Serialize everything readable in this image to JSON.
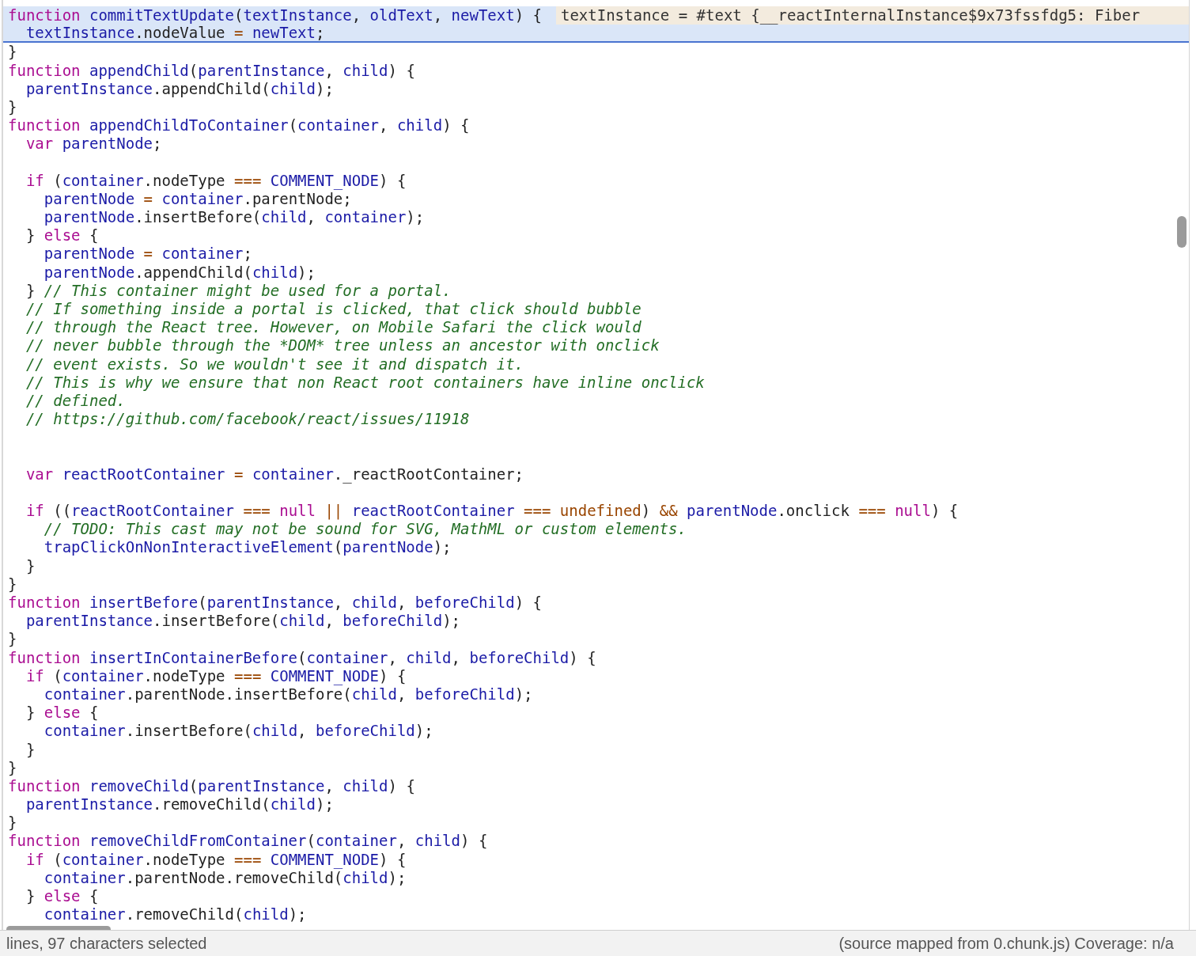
{
  "editor": {
    "lines": [
      {
        "highlighted": true,
        "tokens": [
          {
            "kind": "kw",
            "text": "function"
          },
          {
            "kind": "name",
            "text": " commitTextUpdate"
          },
          {
            "kind": "plain",
            "text": "("
          },
          {
            "kind": "name",
            "text": "textInstance"
          },
          {
            "kind": "plain",
            "text": ", "
          },
          {
            "kind": "name",
            "text": "oldText"
          },
          {
            "kind": "plain",
            "text": ", "
          },
          {
            "kind": "name",
            "text": "newText"
          },
          {
            "kind": "plain",
            "text": ") {"
          }
        ],
        "inline_value": "textInstance = #text {__reactInternalInstance$9x73fssfdg5: Fiber"
      },
      {
        "highlighted": true,
        "tokens": [
          {
            "kind": "name",
            "text": "  textInstance"
          },
          {
            "kind": "plain",
            "text": ".nodeValue "
          },
          {
            "kind": "op",
            "text": "="
          },
          {
            "kind": "name",
            "text": " newText"
          },
          {
            "kind": "plain",
            "text": ";"
          }
        ]
      },
      {
        "highlighted": false,
        "tokens": [
          {
            "kind": "plain",
            "text": "}"
          }
        ]
      },
      {
        "highlighted": false,
        "tokens": [
          {
            "kind": "kw",
            "text": "function"
          },
          {
            "kind": "name",
            "text": " appendChild"
          },
          {
            "kind": "plain",
            "text": "("
          },
          {
            "kind": "name",
            "text": "parentInstance"
          },
          {
            "kind": "plain",
            "text": ", "
          },
          {
            "kind": "name",
            "text": "child"
          },
          {
            "kind": "plain",
            "text": ") {"
          }
        ]
      },
      {
        "highlighted": false,
        "tokens": [
          {
            "kind": "name",
            "text": "  parentInstance"
          },
          {
            "kind": "plain",
            "text": ".appendChild("
          },
          {
            "kind": "name",
            "text": "child"
          },
          {
            "kind": "plain",
            "text": ");"
          }
        ]
      },
      {
        "highlighted": false,
        "tokens": [
          {
            "kind": "plain",
            "text": "}"
          }
        ]
      },
      {
        "highlighted": false,
        "tokens": [
          {
            "kind": "kw",
            "text": "function"
          },
          {
            "kind": "name",
            "text": " appendChildToContainer"
          },
          {
            "kind": "plain",
            "text": "("
          },
          {
            "kind": "name",
            "text": "container"
          },
          {
            "kind": "plain",
            "text": ", "
          },
          {
            "kind": "name",
            "text": "child"
          },
          {
            "kind": "plain",
            "text": ") {"
          }
        ]
      },
      {
        "highlighted": false,
        "tokens": [
          {
            "kind": "kw",
            "text": "  var"
          },
          {
            "kind": "name",
            "text": " parentNode"
          },
          {
            "kind": "plain",
            "text": ";"
          }
        ]
      },
      {
        "highlighted": false
      },
      {
        "highlighted": false,
        "tokens": [
          {
            "kind": "kw",
            "text": "  if"
          },
          {
            "kind": "plain",
            "text": " ("
          },
          {
            "kind": "name",
            "text": "container"
          },
          {
            "kind": "plain",
            "text": ".nodeType "
          },
          {
            "kind": "op",
            "text": "==="
          },
          {
            "kind": "name",
            "text": " COMMENT_NODE"
          },
          {
            "kind": "plain",
            "text": ") {"
          }
        ]
      },
      {
        "highlighted": false,
        "tokens": [
          {
            "kind": "name",
            "text": "    parentNode"
          },
          {
            "kind": "op",
            "text": " ="
          },
          {
            "kind": "name",
            "text": " container"
          },
          {
            "kind": "plain",
            "text": ".parentNode;"
          }
        ]
      },
      {
        "highlighted": false,
        "tokens": [
          {
            "kind": "name",
            "text": "    parentNode"
          },
          {
            "kind": "plain",
            "text": ".insertBefore("
          },
          {
            "kind": "name",
            "text": "child"
          },
          {
            "kind": "plain",
            "text": ", "
          },
          {
            "kind": "name",
            "text": "container"
          },
          {
            "kind": "plain",
            "text": ");"
          }
        ]
      },
      {
        "highlighted": false,
        "tokens": [
          {
            "kind": "plain",
            "text": "  } "
          },
          {
            "kind": "kw",
            "text": "else"
          },
          {
            "kind": "plain",
            "text": " {"
          }
        ]
      },
      {
        "highlighted": false,
        "tokens": [
          {
            "kind": "name",
            "text": "    parentNode"
          },
          {
            "kind": "op",
            "text": " ="
          },
          {
            "kind": "name",
            "text": " container"
          },
          {
            "kind": "plain",
            "text": ";"
          }
        ]
      },
      {
        "highlighted": false,
        "tokens": [
          {
            "kind": "name",
            "text": "    parentNode"
          },
          {
            "kind": "plain",
            "text": ".appendChild("
          },
          {
            "kind": "name",
            "text": "child"
          },
          {
            "kind": "plain",
            "text": ");"
          }
        ]
      },
      {
        "highlighted": false,
        "tokens": [
          {
            "kind": "plain",
            "text": "  } "
          },
          {
            "kind": "comment",
            "text": "// This container might be used for a portal."
          }
        ]
      },
      {
        "highlighted": false,
        "tokens": [
          {
            "kind": "comment",
            "text": "  // If something inside a portal is clicked, that click should bubble"
          }
        ]
      },
      {
        "highlighted": false,
        "tokens": [
          {
            "kind": "comment",
            "text": "  // through the React tree. However, on Mobile Safari the click would"
          }
        ]
      },
      {
        "highlighted": false,
        "tokens": [
          {
            "kind": "comment",
            "text": "  // never bubble through the *DOM* tree unless an ancestor with onclick"
          }
        ]
      },
      {
        "highlighted": false,
        "tokens": [
          {
            "kind": "comment",
            "text": "  // event exists. So we wouldn't see it and dispatch it."
          }
        ]
      },
      {
        "highlighted": false,
        "tokens": [
          {
            "kind": "comment",
            "text": "  // This is why we ensure that non React root containers have inline onclick"
          }
        ]
      },
      {
        "highlighted": false,
        "tokens": [
          {
            "kind": "comment",
            "text": "  // defined."
          }
        ]
      },
      {
        "highlighted": false,
        "tokens": [
          {
            "kind": "comment",
            "text": "  // https://github.com/facebook/react/issues/11918"
          }
        ]
      },
      {
        "highlighted": false
      },
      {
        "highlighted": false
      },
      {
        "highlighted": false,
        "tokens": [
          {
            "kind": "kw",
            "text": "  var"
          },
          {
            "kind": "name",
            "text": " reactRootContainer"
          },
          {
            "kind": "op",
            "text": " ="
          },
          {
            "kind": "name",
            "text": " container"
          },
          {
            "kind": "plain",
            "text": "._reactRootContainer;"
          }
        ]
      },
      {
        "highlighted": false
      },
      {
        "highlighted": false,
        "tokens": [
          {
            "kind": "kw",
            "text": "  if"
          },
          {
            "kind": "plain",
            "text": " (("
          },
          {
            "kind": "name",
            "text": "reactRootContainer"
          },
          {
            "kind": "op",
            "text": " ==="
          },
          {
            "kind": "kw",
            "text": " null"
          },
          {
            "kind": "op",
            "text": " ||"
          },
          {
            "kind": "name",
            "text": " reactRootContainer"
          },
          {
            "kind": "op",
            "text": " ==="
          },
          {
            "kind": "atom",
            "text": " undefined"
          },
          {
            "kind": "plain",
            "text": ") "
          },
          {
            "kind": "op",
            "text": "&&"
          },
          {
            "kind": "name",
            "text": " parentNode"
          },
          {
            "kind": "plain",
            "text": ".onclick "
          },
          {
            "kind": "op",
            "text": "==="
          },
          {
            "kind": "kw",
            "text": " null"
          },
          {
            "kind": "plain",
            "text": ") {"
          }
        ]
      },
      {
        "highlighted": false,
        "tokens": [
          {
            "kind": "comment",
            "text": "    // TODO: This cast may not be sound for SVG, MathML or custom elements."
          }
        ]
      },
      {
        "highlighted": false,
        "tokens": [
          {
            "kind": "name",
            "text": "    trapClickOnNonInteractiveElement"
          },
          {
            "kind": "plain",
            "text": "("
          },
          {
            "kind": "name",
            "text": "parentNode"
          },
          {
            "kind": "plain",
            "text": ");"
          }
        ]
      },
      {
        "highlighted": false,
        "tokens": [
          {
            "kind": "plain",
            "text": "  }"
          }
        ]
      },
      {
        "highlighted": false,
        "tokens": [
          {
            "kind": "plain",
            "text": "}"
          }
        ]
      },
      {
        "highlighted": false,
        "tokens": [
          {
            "kind": "kw",
            "text": "function"
          },
          {
            "kind": "name",
            "text": " insertBefore"
          },
          {
            "kind": "plain",
            "text": "("
          },
          {
            "kind": "name",
            "text": "parentInstance"
          },
          {
            "kind": "plain",
            "text": ", "
          },
          {
            "kind": "name",
            "text": "child"
          },
          {
            "kind": "plain",
            "text": ", "
          },
          {
            "kind": "name",
            "text": "beforeChild"
          },
          {
            "kind": "plain",
            "text": ") {"
          }
        ]
      },
      {
        "highlighted": false,
        "tokens": [
          {
            "kind": "name",
            "text": "  parentInstance"
          },
          {
            "kind": "plain",
            "text": ".insertBefore("
          },
          {
            "kind": "name",
            "text": "child"
          },
          {
            "kind": "plain",
            "text": ", "
          },
          {
            "kind": "name",
            "text": "beforeChild"
          },
          {
            "kind": "plain",
            "text": ");"
          }
        ]
      },
      {
        "highlighted": false,
        "tokens": [
          {
            "kind": "plain",
            "text": "}"
          }
        ]
      },
      {
        "highlighted": false,
        "tokens": [
          {
            "kind": "kw",
            "text": "function"
          },
          {
            "kind": "name",
            "text": " insertInContainerBefore"
          },
          {
            "kind": "plain",
            "text": "("
          },
          {
            "kind": "name",
            "text": "container"
          },
          {
            "kind": "plain",
            "text": ", "
          },
          {
            "kind": "name",
            "text": "child"
          },
          {
            "kind": "plain",
            "text": ", "
          },
          {
            "kind": "name",
            "text": "beforeChild"
          },
          {
            "kind": "plain",
            "text": ") {"
          }
        ]
      },
      {
        "highlighted": false,
        "tokens": [
          {
            "kind": "kw",
            "text": "  if"
          },
          {
            "kind": "plain",
            "text": " ("
          },
          {
            "kind": "name",
            "text": "container"
          },
          {
            "kind": "plain",
            "text": ".nodeType "
          },
          {
            "kind": "op",
            "text": "==="
          },
          {
            "kind": "name",
            "text": " COMMENT_NODE"
          },
          {
            "kind": "plain",
            "text": ") {"
          }
        ]
      },
      {
        "highlighted": false,
        "tokens": [
          {
            "kind": "name",
            "text": "    container"
          },
          {
            "kind": "plain",
            "text": ".parentNode.insertBefore("
          },
          {
            "kind": "name",
            "text": "child"
          },
          {
            "kind": "plain",
            "text": ", "
          },
          {
            "kind": "name",
            "text": "beforeChild"
          },
          {
            "kind": "plain",
            "text": ");"
          }
        ]
      },
      {
        "highlighted": false,
        "tokens": [
          {
            "kind": "plain",
            "text": "  } "
          },
          {
            "kind": "kw",
            "text": "else"
          },
          {
            "kind": "plain",
            "text": " {"
          }
        ]
      },
      {
        "highlighted": false,
        "tokens": [
          {
            "kind": "name",
            "text": "    container"
          },
          {
            "kind": "plain",
            "text": ".insertBefore("
          },
          {
            "kind": "name",
            "text": "child"
          },
          {
            "kind": "plain",
            "text": ", "
          },
          {
            "kind": "name",
            "text": "beforeChild"
          },
          {
            "kind": "plain",
            "text": ");"
          }
        ]
      },
      {
        "highlighted": false,
        "tokens": [
          {
            "kind": "plain",
            "text": "  }"
          }
        ]
      },
      {
        "highlighted": false,
        "tokens": [
          {
            "kind": "plain",
            "text": "}"
          }
        ]
      },
      {
        "highlighted": false,
        "tokens": [
          {
            "kind": "kw",
            "text": "function"
          },
          {
            "kind": "name",
            "text": " removeChild"
          },
          {
            "kind": "plain",
            "text": "("
          },
          {
            "kind": "name",
            "text": "parentInstance"
          },
          {
            "kind": "plain",
            "text": ", "
          },
          {
            "kind": "name",
            "text": "child"
          },
          {
            "kind": "plain",
            "text": ") {"
          }
        ]
      },
      {
        "highlighted": false,
        "tokens": [
          {
            "kind": "name",
            "text": "  parentInstance"
          },
          {
            "kind": "plain",
            "text": ".removeChild("
          },
          {
            "kind": "name",
            "text": "child"
          },
          {
            "kind": "plain",
            "text": ");"
          }
        ]
      },
      {
        "highlighted": false,
        "tokens": [
          {
            "kind": "plain",
            "text": "}"
          }
        ]
      },
      {
        "highlighted": false,
        "tokens": [
          {
            "kind": "kw",
            "text": "function"
          },
          {
            "kind": "name",
            "text": " removeChildFromContainer"
          },
          {
            "kind": "plain",
            "text": "("
          },
          {
            "kind": "name",
            "text": "container"
          },
          {
            "kind": "plain",
            "text": ", "
          },
          {
            "kind": "name",
            "text": "child"
          },
          {
            "kind": "plain",
            "text": ") {"
          }
        ]
      },
      {
        "highlighted": false,
        "tokens": [
          {
            "kind": "kw",
            "text": "  if"
          },
          {
            "kind": "plain",
            "text": " ("
          },
          {
            "kind": "name",
            "text": "container"
          },
          {
            "kind": "plain",
            "text": ".nodeType "
          },
          {
            "kind": "op",
            "text": "==="
          },
          {
            "kind": "name",
            "text": " COMMENT_NODE"
          },
          {
            "kind": "plain",
            "text": ") {"
          }
        ]
      },
      {
        "highlighted": false,
        "tokens": [
          {
            "kind": "name",
            "text": "    container"
          },
          {
            "kind": "plain",
            "text": ".parentNode.removeChild("
          },
          {
            "kind": "name",
            "text": "child"
          },
          {
            "kind": "plain",
            "text": ");"
          }
        ]
      },
      {
        "highlighted": false,
        "tokens": [
          {
            "kind": "plain",
            "text": "  } "
          },
          {
            "kind": "kw",
            "text": "else"
          },
          {
            "kind": "plain",
            "text": " {"
          }
        ]
      },
      {
        "highlighted": false,
        "tokens": [
          {
            "kind": "name",
            "text": "    container"
          },
          {
            "kind": "plain",
            "text": ".removeChild("
          },
          {
            "kind": "name",
            "text": "child"
          },
          {
            "kind": "plain",
            "text": ");"
          }
        ]
      }
    ]
  },
  "status_bar": {
    "selection": "lines, 97 characters selected",
    "source": "(source mapped from 0.chunk.js) Coverage: n/a"
  }
}
